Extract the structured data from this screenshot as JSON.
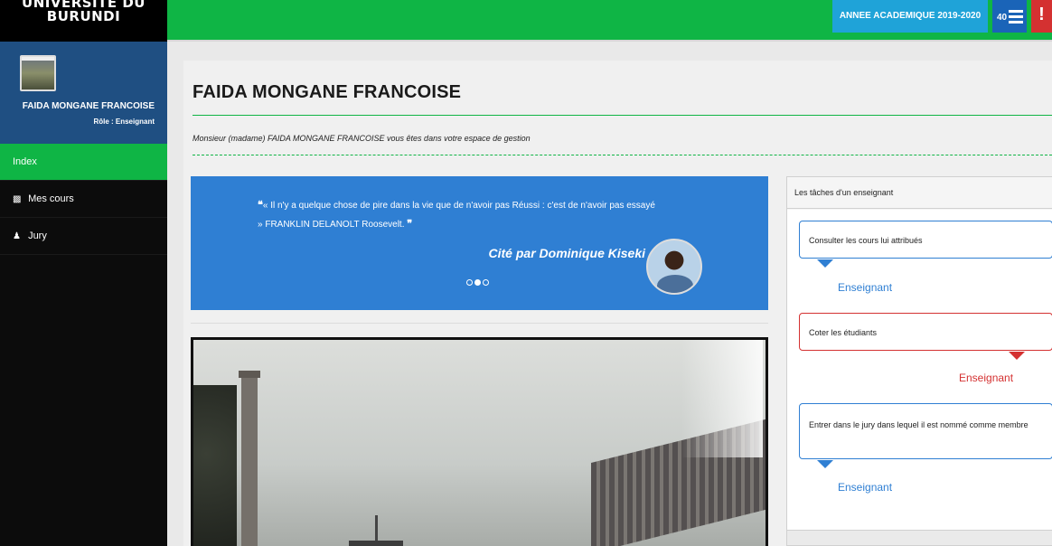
{
  "sidebar": {
    "brand_line1": "UNIVERSITE DU",
    "brand_line2": "BURUNDI",
    "user_name": "FAIDA MONGANE FRANCOISE",
    "user_role": "Rôle : Enseignant",
    "items": [
      {
        "label": "Index",
        "icon": "none",
        "active": true
      },
      {
        "label": "Mes cours",
        "icon": "book-icon",
        "active": false
      },
      {
        "label": "Jury",
        "icon": "user-icon",
        "active": false
      }
    ]
  },
  "topbar": {
    "academic_year": "ANNEE ACADEMIQUE 2019-2020",
    "notification_count": "40",
    "alert_glyph": "!"
  },
  "main": {
    "title": "FAIDA MONGANE FRANCOISE",
    "welcome": "Monsieur (madame) FAIDA MONGANE FRANCOISE vous êtes dans votre espace de gestion",
    "quote_open": "❝",
    "quote_line1": "« Il n'y a quelque chose de pire dans la vie que de n'avoir pas Réussi : c'est de n'avoir pas essayé",
    "quote_line2": "» FRANKLIN DELANOLT Roosevelt.",
    "quote_close": "❞",
    "quote_by": "Cité par Dominique Kiseki",
    "carousel_active": 1
  },
  "tasks": {
    "heading": "Les tâches d'un enseignant",
    "items": [
      {
        "text": "Consulter les cours lui attribués",
        "who": "Enseignant",
        "color": "#2f7fd3"
      },
      {
        "text": "Coter les étudiants",
        "who": "Enseignant",
        "color": "#d43131"
      },
      {
        "text": "Entrer dans le jury dans lequel il est nommé comme membre",
        "who": "Enseignant",
        "color": "#2f7fd3"
      }
    ]
  },
  "colors": {
    "accent_green": "#0fb545",
    "accent_blue": "#2f7fd3",
    "accent_red": "#d43131",
    "profile_blue": "#1f4f82",
    "year_badge": "#1fa3d8"
  }
}
